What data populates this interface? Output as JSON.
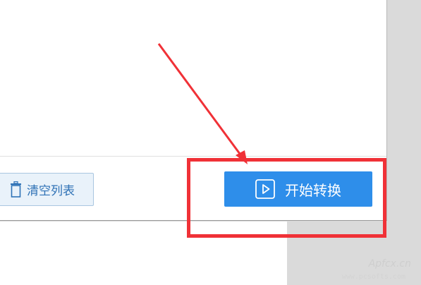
{
  "toolbar": {
    "clear_list_label": "清空列表",
    "start_convert_label": "开始转换"
  },
  "icons": {
    "clear_list": "trash-icon",
    "start_convert": "play-icon"
  },
  "watermark": {
    "brand": "Apfcx.cn",
    "url": "www.pcsofts.com"
  },
  "colors": {
    "primary_button": "#2e8eea",
    "secondary_button_bg": "#e9f2fa",
    "secondary_button_text": "#2f72b6",
    "annotation_red": "#f03137"
  }
}
